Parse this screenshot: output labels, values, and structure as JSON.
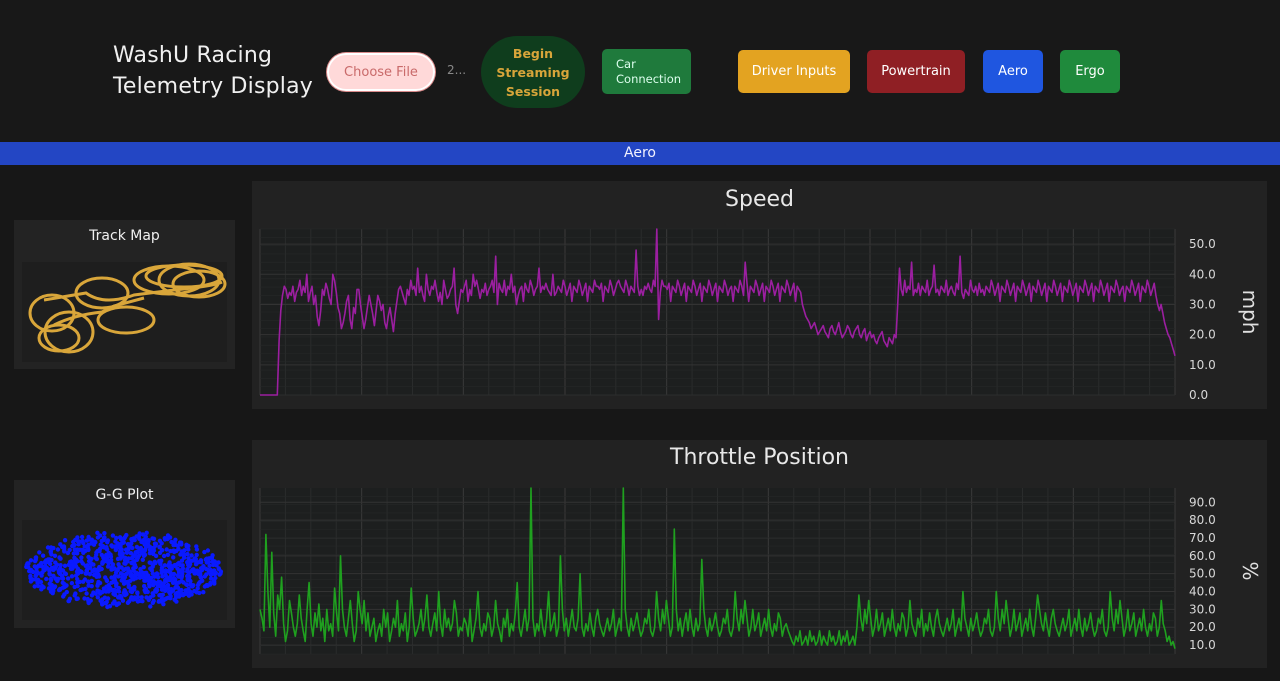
{
  "header": {
    "title_line1": "WashU Racing",
    "title_line2": "Telemetry Display",
    "choose_file_label": "Choose File",
    "file_name": "2...",
    "begin_streaming_label": "Begin Streaming Session",
    "car_connection_label": "Car Connection",
    "nav": {
      "driver_inputs": "Driver Inputs",
      "powertrain": "Powertrain",
      "aero": "Aero",
      "ergo": "Ergo"
    }
  },
  "banner": {
    "label": "Aero"
  },
  "colors": {
    "driver_inputs": "#e3a321",
    "powertrain": "#8f1f24",
    "aero": "#1f56e0",
    "ergo": "#1f8a3c",
    "speed_line": "#9b1fa0",
    "throttle_line": "#1fa01f",
    "track": "#d9a63a",
    "gg": "#0a1aff"
  },
  "track_map": {
    "title": "Track Map"
  },
  "gg_plot": {
    "title": "G-G Plot"
  },
  "chart_data": [
    {
      "type": "line",
      "title": "Speed",
      "ylabel": "mph",
      "yticks": [
        "0.0",
        "10.0",
        "20.0",
        "30.0",
        "40.0",
        "50.0"
      ],
      "ylim": [
        0,
        55
      ],
      "series": [
        {
          "values": [
            0,
            0,
            0,
            0,
            0,
            0,
            0,
            0,
            0,
            0,
            0,
            18,
            28,
            33,
            36,
            35,
            32,
            34,
            33,
            36,
            31,
            34,
            35,
            38,
            33,
            36,
            34,
            40,
            31,
            34,
            36,
            30,
            33,
            26,
            23,
            28,
            35,
            33,
            37,
            35,
            32,
            30,
            40,
            38,
            34,
            29,
            27,
            22,
            24,
            27,
            31,
            33,
            25,
            22,
            29,
            27,
            35,
            35,
            30,
            26,
            22,
            25,
            29,
            33,
            30,
            27,
            23,
            28,
            33,
            31,
            28,
            30,
            24,
            22,
            26,
            29,
            25,
            21,
            27,
            31,
            35,
            36,
            34,
            32,
            30,
            35,
            33,
            38,
            35,
            36,
            33,
            42,
            34,
            36,
            33,
            31,
            40,
            35,
            33,
            36,
            35,
            38,
            34,
            31,
            34,
            30,
            38,
            35,
            32,
            33,
            35,
            36,
            42,
            30,
            27,
            31,
            35,
            34,
            36,
            38,
            31,
            35,
            33,
            40,
            36,
            38,
            35,
            32,
            35,
            34,
            37,
            33,
            35,
            36,
            38,
            34,
            46,
            30,
            37,
            35,
            34,
            38,
            33,
            36,
            35,
            40,
            34,
            36,
            30,
            33,
            35,
            36,
            31,
            37,
            35,
            34,
            38,
            36,
            33,
            35,
            36,
            42,
            34,
            36,
            35,
            37,
            35,
            34,
            33,
            40,
            33,
            34,
            36,
            35,
            34,
            38,
            36,
            33,
            35,
            37,
            31,
            36,
            35,
            34,
            38,
            36,
            33,
            35,
            37,
            31,
            36,
            35,
            34,
            38,
            36,
            36,
            35,
            37,
            31,
            36,
            35,
            34,
            38,
            36,
            33,
            35,
            37,
            38,
            36,
            35,
            34,
            38,
            36,
            33,
            36,
            35,
            34,
            48,
            36,
            33,
            35,
            33,
            36,
            35,
            37,
            35,
            34,
            38,
            36,
            55,
            25,
            34,
            38,
            36,
            36,
            35,
            37,
            31,
            36,
            35,
            34,
            38,
            36,
            33,
            35,
            37,
            31,
            36,
            35,
            34,
            38,
            36,
            33,
            35,
            37,
            31,
            36,
            35,
            34,
            38,
            36,
            33,
            35,
            37,
            31,
            36,
            35,
            34,
            38,
            36,
            33,
            35,
            36,
            31,
            36,
            35,
            34,
            38,
            36,
            33,
            44,
            37,
            31,
            36,
            35,
            34,
            38,
            36,
            33,
            35,
            37,
            31,
            36,
            35,
            34,
            38,
            36,
            33,
            35,
            37,
            31,
            36,
            35,
            34,
            38,
            36,
            33,
            35,
            37,
            31,
            36,
            35,
            34,
            30,
            28,
            26,
            25,
            24,
            22,
            23,
            24,
            22,
            20,
            21,
            22,
            23,
            21,
            20,
            19,
            22,
            23,
            21,
            20,
            22,
            24,
            21,
            19,
            20,
            21,
            23,
            22,
            20,
            19,
            21,
            22,
            23,
            20,
            19,
            21,
            22,
            18,
            20,
            21,
            19,
            20,
            18,
            17,
            19,
            20,
            21,
            18,
            17,
            16,
            19,
            18,
            17,
            20,
            19,
            30,
            42,
            35,
            33,
            38,
            34,
            36,
            35,
            44,
            33,
            35,
            34,
            37,
            33,
            36,
            35,
            34,
            38,
            33,
            35,
            36,
            43,
            34,
            35,
            33,
            36,
            35,
            34,
            38,
            33,
            35,
            36,
            34,
            33,
            37,
            35,
            46,
            34,
            32,
            35,
            34,
            33,
            38,
            35,
            34,
            36,
            33,
            37,
            34,
            35,
            33,
            36,
            35,
            34,
            38,
            36,
            33,
            35,
            37,
            31,
            36,
            35,
            34,
            38,
            36,
            33,
            35,
            37,
            31,
            36,
            35,
            34,
            38,
            36,
            33,
            35,
            37,
            31,
            36,
            35,
            34,
            38,
            36,
            33,
            35,
            37,
            31,
            36,
            35,
            34,
            38,
            36,
            33,
            35,
            37,
            31,
            36,
            35,
            34,
            38,
            36,
            33,
            35,
            37,
            31,
            36,
            35,
            34,
            38,
            36,
            33,
            35,
            37,
            31,
            36,
            35,
            34,
            38,
            36,
            33,
            35,
            37,
            31,
            36,
            35,
            34,
            38,
            36,
            33,
            35,
            36,
            31,
            36,
            35,
            34,
            38,
            36,
            33,
            35,
            37,
            31,
            36,
            35,
            34,
            38,
            36,
            33,
            35,
            37,
            33,
            30,
            28,
            30,
            27,
            24,
            22,
            20,
            19,
            17,
            15,
            13
          ]
        }
      ]
    },
    {
      "type": "line",
      "title": "Throttle Position",
      "ylabel": "%",
      "yticks": [
        "10.0",
        "20.0",
        "30.0",
        "40.0",
        "50.0",
        "60.0",
        "70.0",
        "80.0",
        "90.0"
      ],
      "ylim": [
        5,
        98
      ],
      "series": [
        {
          "values": [
            30,
            25,
            18,
            72,
            40,
            20,
            62,
            28,
            15,
            38,
            30,
            48,
            22,
            12,
            18,
            35,
            28,
            20,
            15,
            22,
            38,
            25,
            18,
            12,
            30,
            45,
            22,
            15,
            28,
            20,
            33,
            18,
            25,
            12,
            30,
            18,
            22,
            15,
            42,
            28,
            18,
            60,
            30,
            20,
            15,
            25,
            35,
            22,
            12,
            18,
            40,
            30,
            22,
            35,
            18,
            28,
            15,
            20,
            25,
            12,
            18,
            22,
            15,
            30,
            20,
            28,
            12,
            18,
            25,
            20,
            35,
            15,
            22,
            18,
            28,
            12,
            20,
            42,
            25,
            15,
            18,
            22,
            30,
            18,
            25,
            38,
            20,
            15,
            22,
            28,
            18,
            40,
            22,
            15,
            30,
            20,
            25,
            18,
            22,
            35,
            28,
            15,
            20,
            18,
            25,
            22,
            15,
            30,
            12,
            18,
            25,
            40,
            20,
            15,
            22,
            18,
            28,
            25,
            15,
            20,
            35,
            22,
            18,
            12,
            25,
            20,
            30,
            15,
            22,
            18,
            28,
            45,
            20,
            15,
            22,
            30,
            18,
            25,
            98,
            25,
            15,
            22,
            18,
            30,
            20,
            15,
            25,
            40,
            18,
            22,
            28,
            15,
            20,
            60,
            30,
            18,
            25,
            15,
            22,
            30,
            20,
            18,
            25,
            50,
            20,
            15,
            22,
            18,
            28,
            20,
            15,
            25,
            30,
            22,
            18,
            15,
            20,
            25,
            18,
            22,
            30,
            15,
            20,
            25,
            18,
            98,
            30,
            20,
            15,
            25,
            18,
            22,
            28,
            20,
            15,
            18,
            25,
            22,
            30,
            18,
            15,
            20,
            40,
            25,
            18,
            30,
            22,
            35,
            25,
            15,
            20,
            75,
            30,
            18,
            25,
            15,
            22,
            28,
            18,
            30,
            20,
            15,
            25,
            18,
            22,
            58,
            30,
            20,
            15,
            25,
            18,
            22,
            28,
            20,
            15,
            18,
            25,
            22,
            30,
            18,
            15,
            20,
            40,
            25,
            18,
            30,
            22,
            35,
            25,
            15,
            20,
            30,
            18,
            22,
            28,
            15,
            20,
            25,
            18,
            30,
            20,
            15,
            22,
            18,
            28,
            25,
            15,
            20,
            22,
            18,
            15,
            12,
            10,
            15,
            12,
            18,
            10,
            12,
            15,
            10,
            18,
            12,
            15,
            10,
            12,
            18,
            10,
            15,
            12,
            10,
            18,
            12,
            15,
            10,
            12,
            18,
            10,
            15,
            12,
            18,
            10,
            12,
            15,
            10,
            20,
            38,
            25,
            18,
            30,
            22,
            35,
            25,
            15,
            20,
            30,
            18,
            22,
            28,
            15,
            20,
            25,
            18,
            30,
            20,
            15,
            22,
            18,
            28,
            25,
            15,
            20,
            35,
            22,
            18,
            15,
            25,
            20,
            30,
            15,
            22,
            18,
            28,
            20,
            15,
            25,
            30,
            22,
            18,
            15,
            20,
            25,
            18,
            22,
            30,
            15,
            20,
            25,
            18,
            40,
            25,
            20,
            15,
            25,
            18,
            22,
            28,
            20,
            15,
            18,
            25,
            22,
            30,
            18,
            15,
            20,
            40,
            25,
            18,
            30,
            22,
            35,
            25,
            15,
            20,
            30,
            18,
            22,
            28,
            15,
            20,
            25,
            18,
            30,
            20,
            15,
            25,
            38,
            30,
            22,
            18,
            28,
            20,
            15,
            25,
            30,
            22,
            18,
            15,
            20,
            25,
            18,
            22,
            30,
            15,
            20,
            25,
            18,
            30,
            20,
            15,
            25,
            18,
            22,
            28,
            20,
            15,
            18,
            25,
            22,
            30,
            18,
            15,
            20,
            40,
            25,
            18,
            30,
            22,
            35,
            25,
            15,
            20,
            30,
            18,
            22,
            28,
            15,
            20,
            25,
            18,
            30,
            20,
            15,
            22,
            18,
            28,
            25,
            15,
            20,
            35,
            22,
            18,
            12,
            15,
            10,
            12,
            8
          ]
        }
      ]
    }
  ]
}
